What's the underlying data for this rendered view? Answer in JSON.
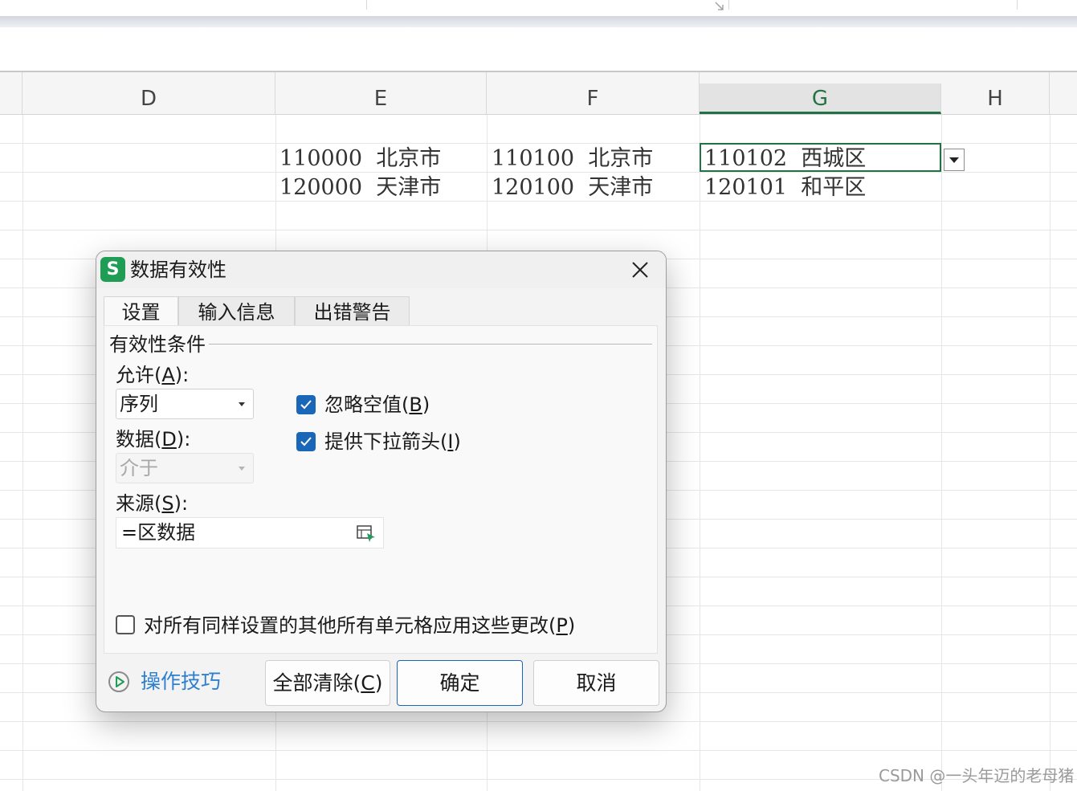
{
  "columns": [
    "D",
    "E",
    "F",
    "G",
    "H"
  ],
  "active_column": "G",
  "cells": {
    "E2": "110000  北京市",
    "E3": "120000  天津市",
    "F2": "110100  北京市",
    "F3": "120100  天津市",
    "G2": "110102  西城区",
    "G3": "120101  和平区"
  },
  "dialog": {
    "title": "数据有效性",
    "app_icon_letter": "S",
    "tabs": [
      "设置",
      "输入信息",
      "出错警告"
    ],
    "selected_tab": "设置",
    "group_label": "有效性条件",
    "allow": {
      "label": "允许",
      "mnemonic": "A",
      "value": "序列"
    },
    "data": {
      "label": "数据",
      "mnemonic": "D",
      "value": "介于",
      "disabled": true
    },
    "ignore_blank": {
      "label": "忽略空值",
      "mnemonic": "B",
      "checked": true
    },
    "in_cell_dropdown": {
      "label": "提供下拉箭头",
      "mnemonic": "I",
      "checked": true
    },
    "source": {
      "label": "来源",
      "mnemonic": "S",
      "value": "=区数据"
    },
    "apply_all": {
      "label": "对所有同样设置的其他所有单元格应用这些更改",
      "mnemonic": "P",
      "checked": false
    },
    "tips_link": "操作技巧",
    "buttons": {
      "clear_all": {
        "label": "全部清除",
        "mnemonic": "C"
      },
      "ok": "确定",
      "cancel": "取消"
    }
  },
  "colors": {
    "accent_green": "#217346",
    "checkbox_blue": "#1a67b7",
    "link_blue": "#2d7fd0",
    "app_icon_green": "#1f9d55"
  },
  "watermark": "CSDN @一头年迈的老母猪"
}
